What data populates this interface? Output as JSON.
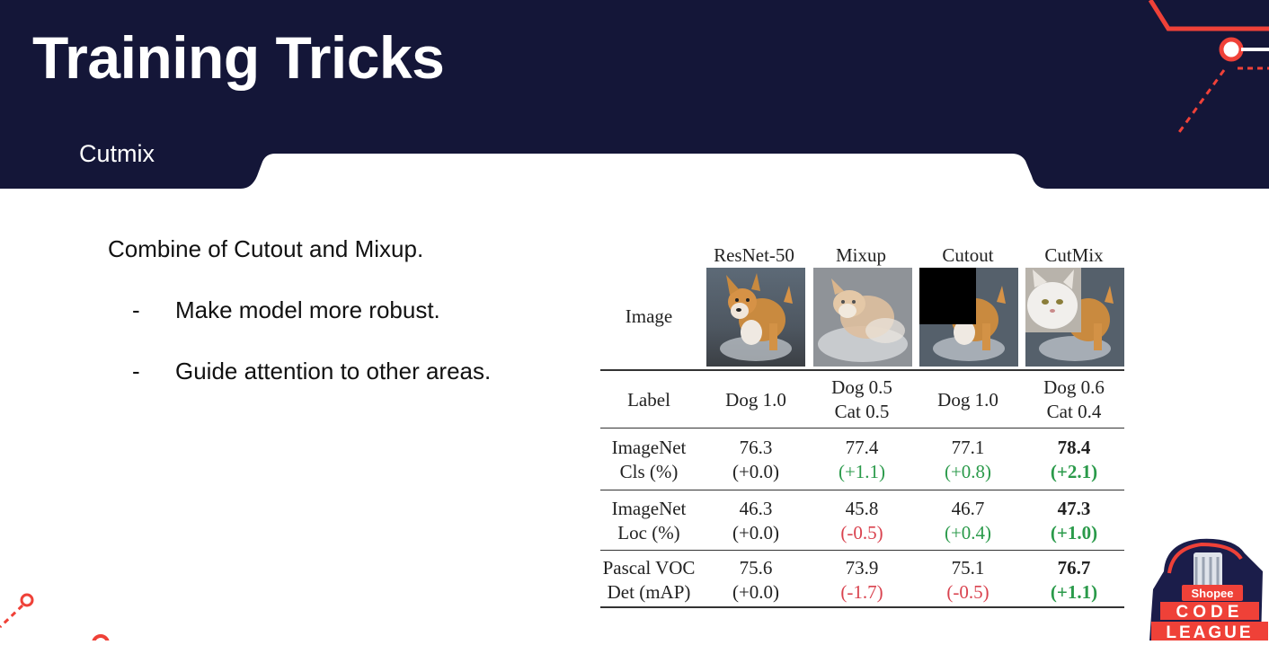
{
  "header": {
    "title": "Training Tricks",
    "subtitle": "Cutmix",
    "colors": {
      "navy": "#141638",
      "accent": "#ef4138"
    }
  },
  "content": {
    "lead": "Combine of Cutout and Mixup.",
    "bullets": [
      {
        "dash": "-",
        "text": "Make model more robust."
      },
      {
        "dash": "-",
        "text": "Guide attention to other areas."
      }
    ]
  },
  "table": {
    "columns": [
      "ResNet-50",
      "Mixup",
      "Cutout",
      "CutMix"
    ],
    "image_row_label": "Image",
    "rows": [
      {
        "label": [
          "Label"
        ],
        "cells": [
          {
            "line1": "Dog 1.0",
            "line2": ""
          },
          {
            "line1": "Dog 0.5",
            "line2": "Cat 0.5"
          },
          {
            "line1": "Dog 1.0",
            "line2": ""
          },
          {
            "line1": "Dog 0.6",
            "line2": "Cat 0.4"
          }
        ]
      },
      {
        "label": [
          "ImageNet",
          "Cls (%)"
        ],
        "cells": [
          {
            "value": "76.3",
            "delta": "(+0.0)",
            "tone": "neutral"
          },
          {
            "value": "77.4",
            "delta": "(+1.1)",
            "tone": "up"
          },
          {
            "value": "77.1",
            "delta": "(+0.8)",
            "tone": "up"
          },
          {
            "value": "78.4",
            "delta": "(+2.1)",
            "tone": "up",
            "best": true
          }
        ]
      },
      {
        "label": [
          "ImageNet",
          "Loc (%)"
        ],
        "cells": [
          {
            "value": "46.3",
            "delta": "(+0.0)",
            "tone": "neutral"
          },
          {
            "value": "45.8",
            "delta": "(-0.5)",
            "tone": "down"
          },
          {
            "value": "46.7",
            "delta": "(+0.4)",
            "tone": "up"
          },
          {
            "value": "47.3",
            "delta": "(+1.0)",
            "tone": "up",
            "best": true
          }
        ]
      },
      {
        "label": [
          "Pascal VOC",
          "Det (mAP)"
        ],
        "cells": [
          {
            "value": "75.6",
            "delta": "(+0.0)",
            "tone": "neutral"
          },
          {
            "value": "73.9",
            "delta": "(-1.7)",
            "tone": "down"
          },
          {
            "value": "75.1",
            "delta": "(-0.5)",
            "tone": "down"
          },
          {
            "value": "76.7",
            "delta": "(+1.1)",
            "tone": "up",
            "best": true
          }
        ]
      }
    ],
    "colors": {
      "up": "#2a9a4a",
      "down": "#d9434f"
    }
  },
  "logo": {
    "brand": "Shopee",
    "word1": "CODE",
    "word2": "LEAGUE"
  }
}
